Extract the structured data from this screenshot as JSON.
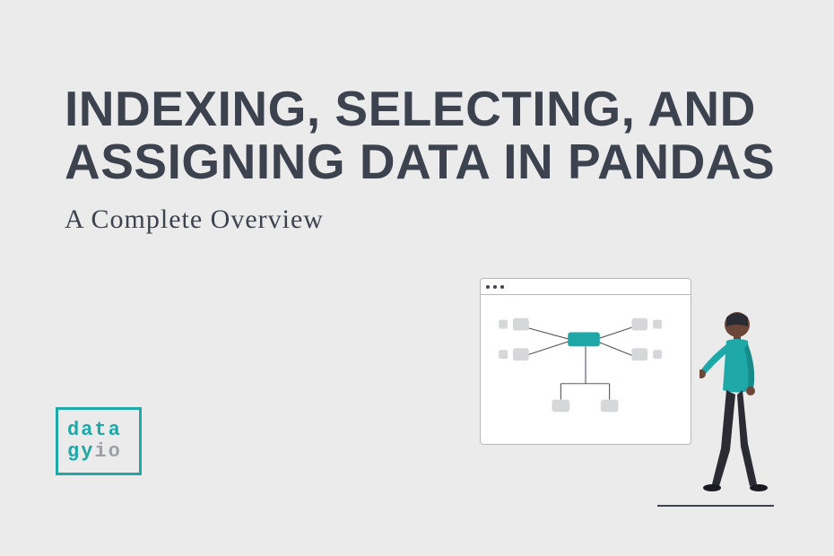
{
  "title": "INDEXING, SELECTING, AND ASSIGNING DATA IN PANDAS",
  "subtitle": "A Complete Overview",
  "logo": {
    "line1": "data",
    "gy": "gy",
    "io": "io"
  },
  "colors": {
    "teal": "#1fa8a8",
    "dark": "#3c434f",
    "gray": "#9ca0a6",
    "lightgray": "#d6d7d9",
    "bg": "#ebebeb"
  }
}
